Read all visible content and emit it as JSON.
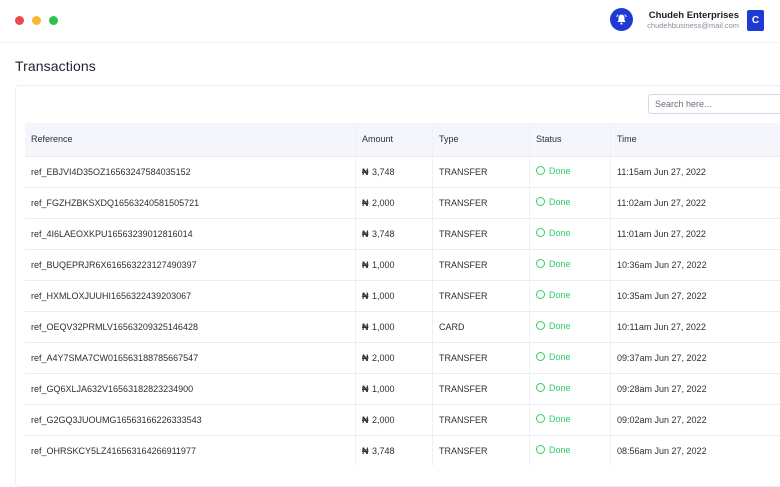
{
  "window": {
    "controls": [
      "close",
      "minimize",
      "maximize"
    ]
  },
  "header": {
    "notification_icon": "bell-icon",
    "company_name": "Chudeh Enterprises",
    "company_email": "chudehbusiness@mail.com",
    "avatar_initial": "C"
  },
  "page": {
    "title": "Transactions"
  },
  "search": {
    "placeholder": "Search here..."
  },
  "colors": {
    "accent": "#1f3ad4",
    "status_done": "#2fcf62"
  },
  "table": {
    "columns": [
      "Reference",
      "Amount",
      "Type",
      "Status",
      "Time"
    ],
    "rows": [
      {
        "reference": "ref_EBJVI4D35OZ16563247584035152",
        "currency": "₦",
        "amount": "3,748",
        "type": "TRANSFER",
        "status": "Done",
        "time": "11:15am Jun 27, 2022"
      },
      {
        "reference": "ref_FGZHZBKSXDQ16563240581505721",
        "currency": "₦",
        "amount": "2,000",
        "type": "TRANSFER",
        "status": "Done",
        "time": "11:02am Jun 27, 2022"
      },
      {
        "reference": "ref_4I6LAEOXKPU16563239012816014",
        "currency": "₦",
        "amount": "3,748",
        "type": "TRANSFER",
        "status": "Done",
        "time": "11:01am Jun 27, 2022"
      },
      {
        "reference": "ref_BUQEPRJR6X616563223127490397",
        "currency": "₦",
        "amount": "1,000",
        "type": "TRANSFER",
        "status": "Done",
        "time": "10:36am Jun 27, 2022"
      },
      {
        "reference": "ref_HXMLOXJUUHI16563224392030​67",
        "currency": "₦",
        "amount": "1,000",
        "type": "TRANSFER",
        "status": "Done",
        "time": "10:35am Jun 27, 2022"
      },
      {
        "reference": "ref_OEQV32PRMLV16563209325146428",
        "currency": "₦",
        "amount": "1,000",
        "type": "CARD",
        "status": "Done",
        "time": "10:11am Jun 27, 2022"
      },
      {
        "reference": "ref_A4Y7SMA7CW016563188785667547",
        "currency": "₦",
        "amount": "2,000",
        "type": "TRANSFER",
        "status": "Done",
        "time": "09:37am Jun 27, 2022"
      },
      {
        "reference": "ref_GQ6XLJA632V16563182823234900",
        "currency": "₦",
        "amount": "1,000",
        "type": "TRANSFER",
        "status": "Done",
        "time": "09:28am Jun 27, 2022"
      },
      {
        "reference": "ref_G2GQ3JUOUMG16563166226333543",
        "currency": "₦",
        "amount": "2,000",
        "type": "TRANSFER",
        "status": "Done",
        "time": "09:02am Jun 27, 2022"
      },
      {
        "reference": "ref_OHRSKCY5LZ416563164266911977",
        "currency": "₦",
        "amount": "3,748",
        "type": "TRANSFER",
        "status": "Done",
        "time": "08:56am Jun 27, 2022"
      }
    ]
  }
}
